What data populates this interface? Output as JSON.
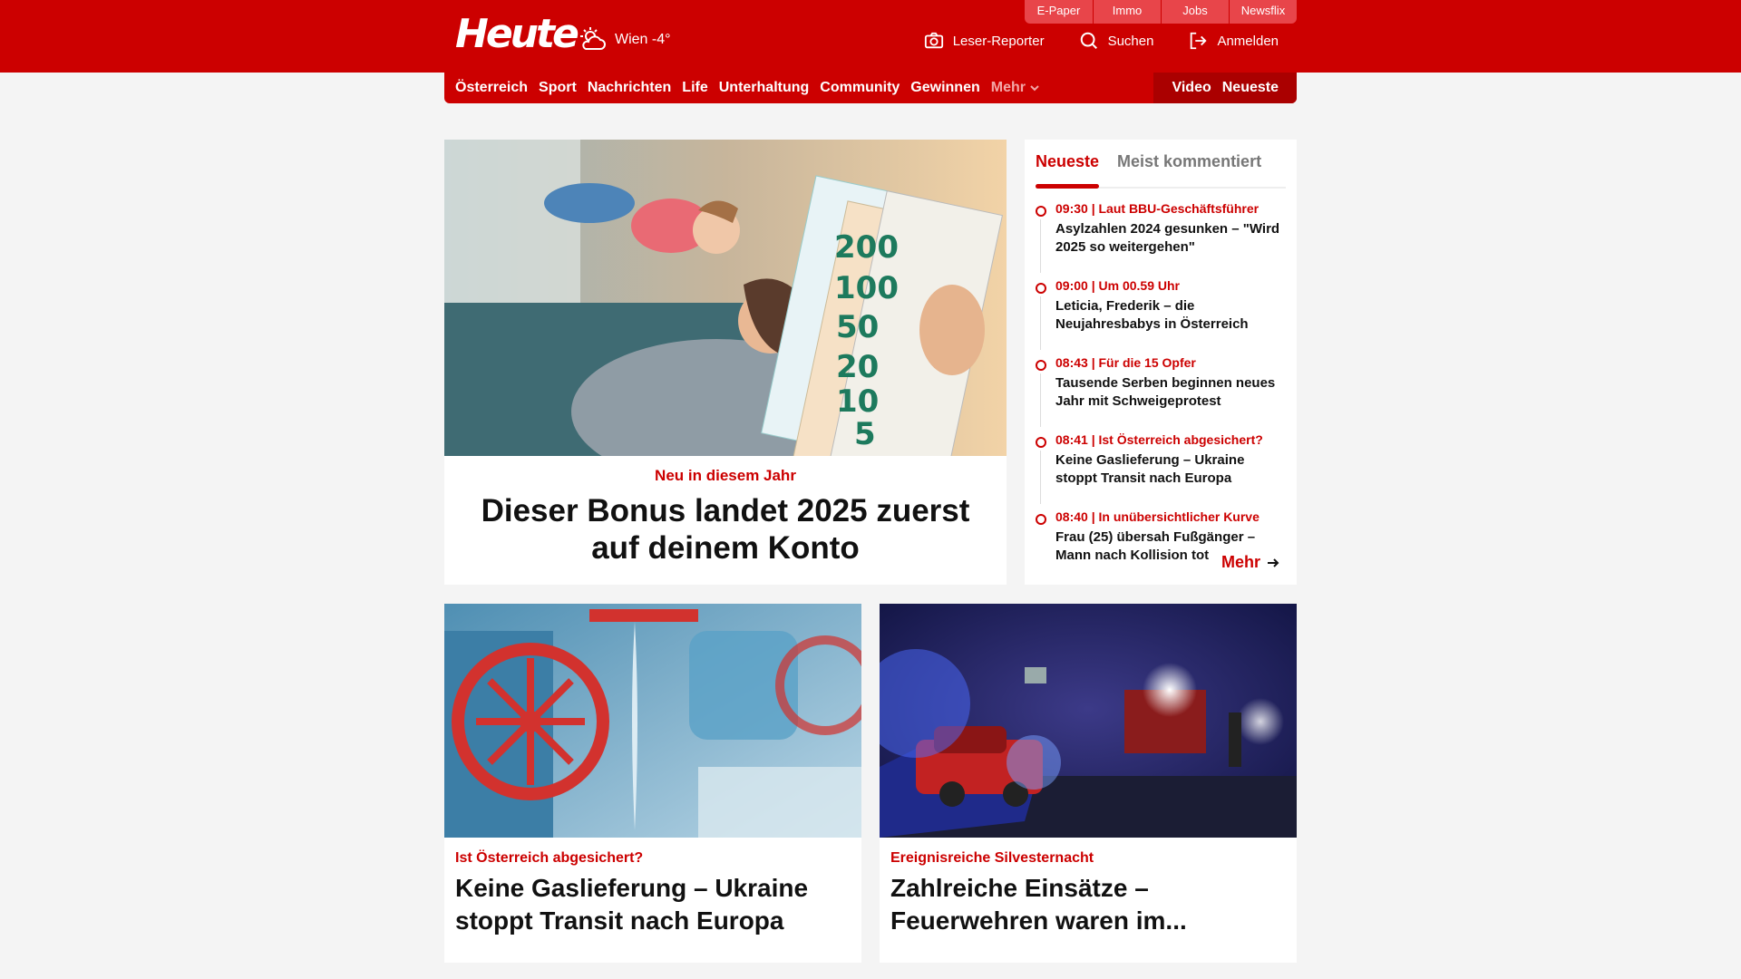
{
  "header": {
    "logo": "Heute",
    "weather": "Wien -4°",
    "minitabs": [
      "E-Paper",
      "Immo",
      "Jobs",
      "Newsflix"
    ],
    "actions": [
      {
        "label": "Leser-Reporter",
        "icon": "camera-icon"
      },
      {
        "label": "Suchen",
        "icon": "search-icon"
      },
      {
        "label": "Anmelden",
        "icon": "login-icon"
      }
    ]
  },
  "nav": {
    "items": [
      "Österreich",
      "Sport",
      "Nachrichten",
      "Life",
      "Unterhaltung",
      "Community",
      "Gewinnen"
    ],
    "more": "Mehr",
    "right": [
      "Video",
      "Neueste"
    ]
  },
  "hero": {
    "kicker": "Neu in diesem Jahr",
    "title": "Dieser Bonus landet 2025 zuerst auf deinem Konto"
  },
  "sidebar": {
    "tabs": [
      "Neueste",
      "Meist kommentiert"
    ],
    "items": [
      {
        "meta": "09:30 | Laut BBU-Geschäftsführer",
        "title": "Asylzahlen 2024 gesunken – \"Wird 2025 so weitergehen\""
      },
      {
        "meta": "09:00 | Um 00.59 Uhr",
        "title": "Leticia, Frederik – die Neujahresbabys in Österreich"
      },
      {
        "meta": "08:43 | Für die 15 Opfer",
        "title": "Tausende Serben beginnen neues Jahr mit Schweigeprotest"
      },
      {
        "meta": "08:41 | Ist Österreich abgesichert?",
        "title": "Keine Gaslieferung – Ukraine stoppt Transit nach Europa"
      },
      {
        "meta": "08:40 | In unübersichtlicher Kurve",
        "title": "Frau (25) übersah Fußgänger – Mann nach Kollision tot"
      }
    ],
    "more": "Mehr"
  },
  "cards": [
    {
      "kicker": "Ist Österreich abgesichert?",
      "title": "Keine Gaslieferung – Ukraine stoppt Transit nach Europa"
    },
    {
      "kicker": "Ereignisreiche Silvesternacht",
      "title": "Zahlreiche Einsätze – Feuerwehren waren im..."
    }
  ],
  "colors": {
    "brand": "#cc0000",
    "brand_dark": "#aa0000",
    "background": "#f4f4f4"
  }
}
